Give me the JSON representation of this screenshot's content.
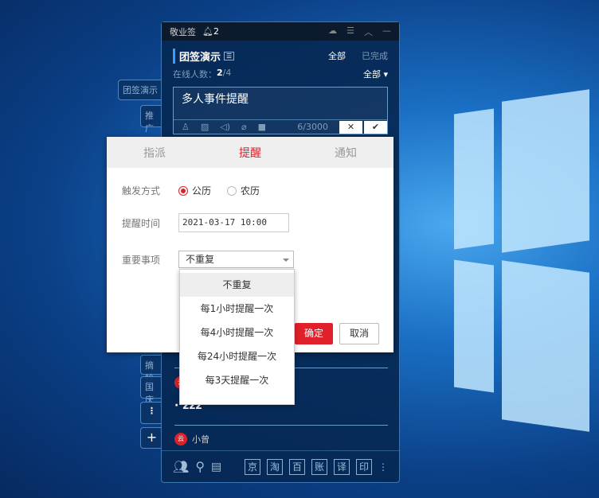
{
  "widget": {
    "app_name": "敬业签",
    "bell_count": "2",
    "group_title": "团签演示",
    "filter_all": "全部",
    "filter_done": "已完成",
    "online_label": "在线人数：",
    "online_count": "2",
    "online_total": "/4",
    "member_filter": "全部",
    "editor_text": "多人事件提醒",
    "char_count": "6/3000"
  },
  "left_tabs": [
    "团签演示",
    "推广",
    "摘抄",
    "国庆",
    "⋮",
    "+"
  ],
  "list": {
    "item_text": "· zzz",
    "user2": "小曾"
  },
  "footer_keys": [
    "京",
    "淘",
    "百",
    "账",
    "译",
    "印"
  ],
  "dialog": {
    "tabs": [
      "指派",
      "提醒",
      "通知"
    ],
    "active_tab": "提醒",
    "trigger_label": "触发方式",
    "solar": "公历",
    "lunar": "农历",
    "selected_calendar": "公历",
    "time_label": "提醒时间",
    "time_value": "2021-03-17 10:00",
    "repeat_label": "重要事项",
    "repeat_value": "不重复",
    "ok": "确定",
    "cancel": "取消"
  },
  "dropdown": {
    "options": [
      "不重复",
      "每1小时提醒一次",
      "每4小时提醒一次",
      "每24小时提醒一次",
      "每3天提醒一次"
    ],
    "selected": "不重复"
  },
  "colors": {
    "accent": "#d9232b",
    "panel": "#062854"
  }
}
